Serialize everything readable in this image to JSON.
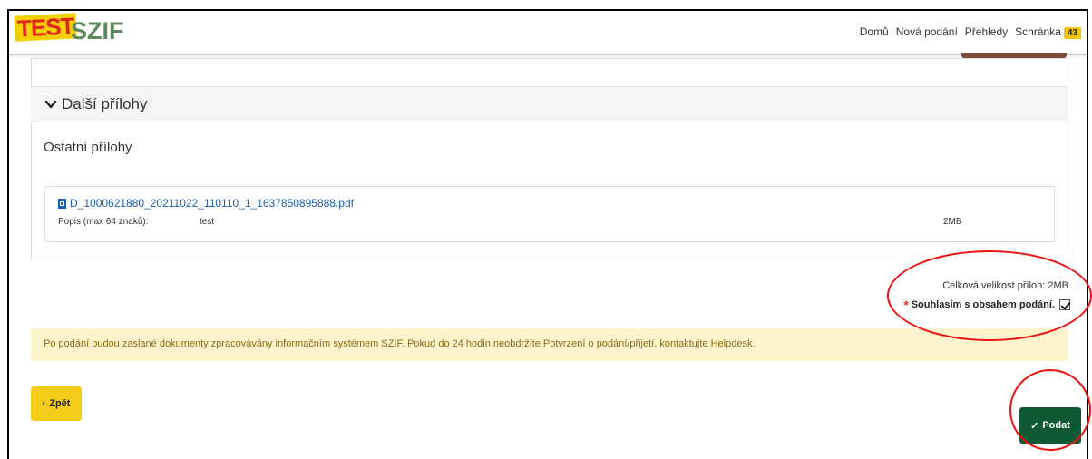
{
  "logo": {
    "test": "TEST",
    "brand": "SZIF"
  },
  "nav": {
    "items": [
      "Domů",
      "Nová podání",
      "Přehledy",
      "Schránka"
    ],
    "badge": "43"
  },
  "section": {
    "header": "Další přílohy",
    "title": "Ostatní přílohy"
  },
  "file": {
    "name": "D_1000621880_20211022_110110_1_1637850895888.pdf",
    "desc_label": "Popis (max 64 znaků):",
    "desc_value": "test",
    "size": "2MB"
  },
  "summary": {
    "total": "Celková velikost příloh: 2MB",
    "consent_star": "*",
    "consent": "Souhlasím s obsahem podání.",
    "consent_checked": true
  },
  "notice": "Po podání budou zaslané dokumenty zpracovávány informačním systémem SZIF. Pokud do 24 hodin neobdržíte Potvrzení o podání/přijetí, kontaktujte Helpdesk.",
  "buttons": {
    "back_icon": "‹",
    "back": "Zpět",
    "submit_icon": "✓",
    "submit": "Podat"
  },
  "colors": {
    "accent_green": "#0d5a33",
    "yellow": "#f5cb1a",
    "notice_bg": "#fdf4cc",
    "annotation_red": "#e11"
  }
}
